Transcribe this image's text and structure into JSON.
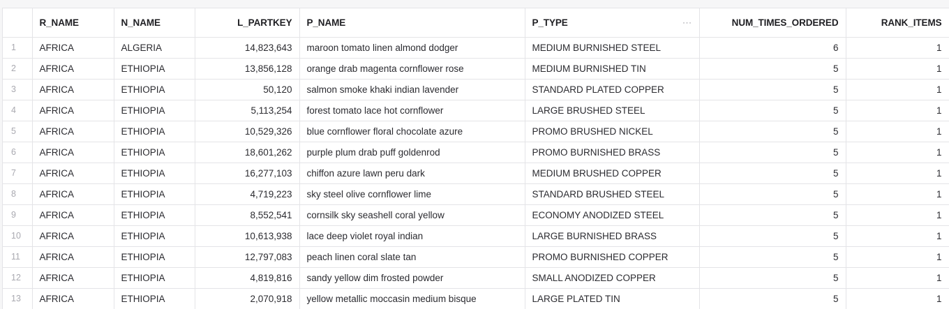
{
  "table": {
    "columns": [
      "R_NAME",
      "N_NAME",
      "L_PARTKEY",
      "P_NAME",
      "P_TYPE",
      "NUM_TIMES_ORDERED",
      "RANK_ITEMS"
    ],
    "column_menu_icon": "more-horizontal-icon",
    "rows": [
      {
        "n": "1",
        "r_name": "AFRICA",
        "n_name": "ALGERIA",
        "l_partkey": "14,823,643",
        "p_name": "maroon tomato linen almond dodger",
        "p_type": "MEDIUM BURNISHED STEEL",
        "num_times_ordered": "6",
        "rank_items": "1"
      },
      {
        "n": "2",
        "r_name": "AFRICA",
        "n_name": "ETHIOPIA",
        "l_partkey": "13,856,128",
        "p_name": "orange drab magenta cornflower rose",
        "p_type": "MEDIUM BURNISHED TIN",
        "num_times_ordered": "5",
        "rank_items": "1"
      },
      {
        "n": "3",
        "r_name": "AFRICA",
        "n_name": "ETHIOPIA",
        "l_partkey": "50,120",
        "p_name": "salmon smoke khaki indian lavender",
        "p_type": "STANDARD PLATED COPPER",
        "num_times_ordered": "5",
        "rank_items": "1"
      },
      {
        "n": "4",
        "r_name": "AFRICA",
        "n_name": "ETHIOPIA",
        "l_partkey": "5,113,254",
        "p_name": "forest tomato lace hot cornflower",
        "p_type": "LARGE BRUSHED STEEL",
        "num_times_ordered": "5",
        "rank_items": "1"
      },
      {
        "n": "5",
        "r_name": "AFRICA",
        "n_name": "ETHIOPIA",
        "l_partkey": "10,529,326",
        "p_name": "blue cornflower floral chocolate azure",
        "p_type": "PROMO BRUSHED NICKEL",
        "num_times_ordered": "5",
        "rank_items": "1"
      },
      {
        "n": "6",
        "r_name": "AFRICA",
        "n_name": "ETHIOPIA",
        "l_partkey": "18,601,262",
        "p_name": "purple plum drab puff goldenrod",
        "p_type": "PROMO BURNISHED BRASS",
        "num_times_ordered": "5",
        "rank_items": "1"
      },
      {
        "n": "7",
        "r_name": "AFRICA",
        "n_name": "ETHIOPIA",
        "l_partkey": "16,277,103",
        "p_name": "chiffon azure lawn peru dark",
        "p_type": "MEDIUM BRUSHED COPPER",
        "num_times_ordered": "5",
        "rank_items": "1"
      },
      {
        "n": "8",
        "r_name": "AFRICA",
        "n_name": "ETHIOPIA",
        "l_partkey": "4,719,223",
        "p_name": "sky steel olive cornflower lime",
        "p_type": "STANDARD BRUSHED STEEL",
        "num_times_ordered": "5",
        "rank_items": "1"
      },
      {
        "n": "9",
        "r_name": "AFRICA",
        "n_name": "ETHIOPIA",
        "l_partkey": "8,552,541",
        "p_name": "cornsilk sky seashell coral yellow",
        "p_type": "ECONOMY ANODIZED STEEL",
        "num_times_ordered": "5",
        "rank_items": "1"
      },
      {
        "n": "10",
        "r_name": "AFRICA",
        "n_name": "ETHIOPIA",
        "l_partkey": "10,613,938",
        "p_name": "lace deep violet royal indian",
        "p_type": "LARGE BURNISHED BRASS",
        "num_times_ordered": "5",
        "rank_items": "1"
      },
      {
        "n": "11",
        "r_name": "AFRICA",
        "n_name": "ETHIOPIA",
        "l_partkey": "12,797,083",
        "p_name": "peach linen coral slate tan",
        "p_type": "PROMO BURNISHED COPPER",
        "num_times_ordered": "5",
        "rank_items": "1"
      },
      {
        "n": "12",
        "r_name": "AFRICA",
        "n_name": "ETHIOPIA",
        "l_partkey": "4,819,816",
        "p_name": "sandy yellow dim frosted powder",
        "p_type": "SMALL ANODIZED COPPER",
        "num_times_ordered": "5",
        "rank_items": "1"
      },
      {
        "n": "13",
        "r_name": "AFRICA",
        "n_name": "ETHIOPIA",
        "l_partkey": "2,070,918",
        "p_name": "yellow metallic moccasin medium bisque",
        "p_type": "LARGE PLATED TIN",
        "num_times_ordered": "5",
        "rank_items": "1"
      }
    ]
  }
}
